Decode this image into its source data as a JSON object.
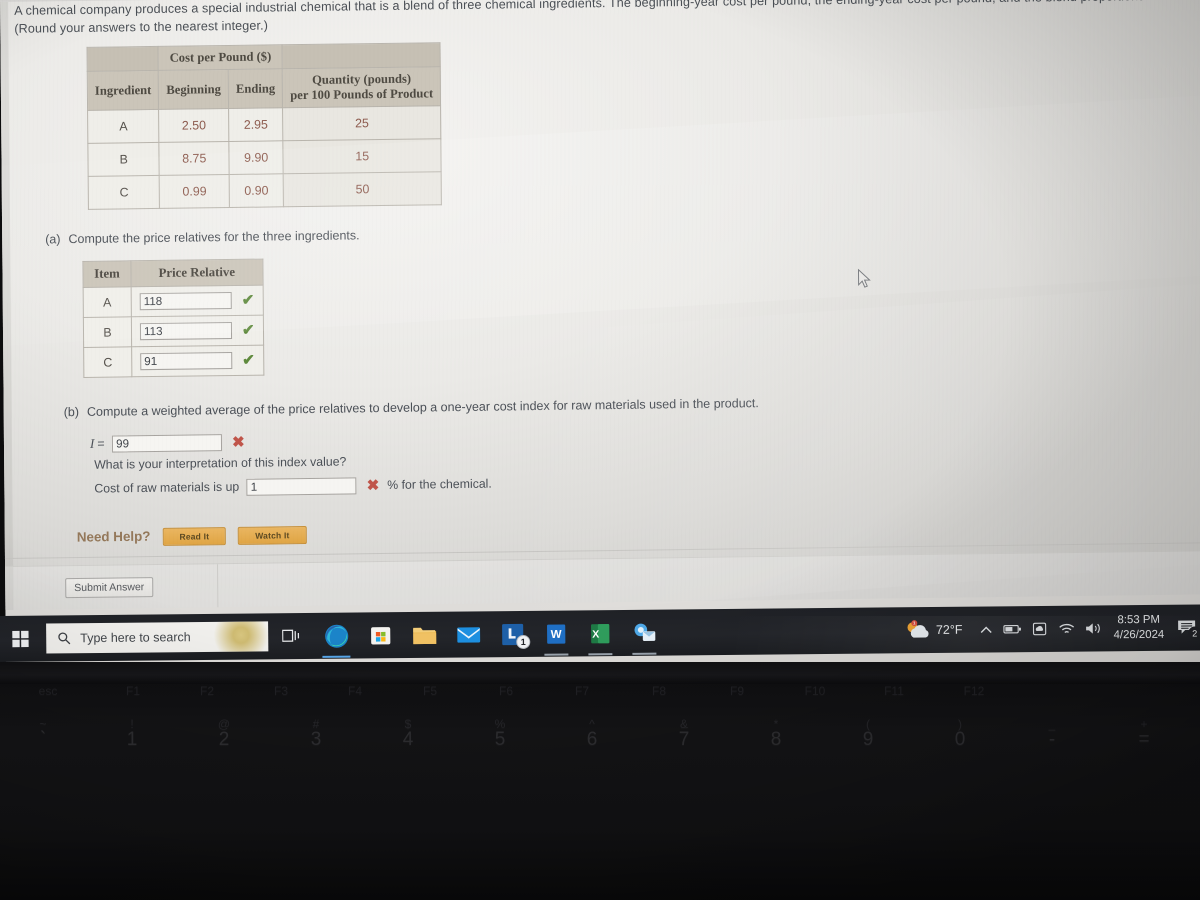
{
  "question": {
    "prompt_line1": "A chemical company produces a special industrial chemical that is a blend of three chemical ingredients. The beginning-year cost per pound, the ending-year cost per pound, and the blend proportions follow.",
    "prompt_line2": "(Round your answers to the nearest integer.)"
  },
  "data_table": {
    "group_header": "Cost per Pound ($)",
    "headers": [
      "Ingredient",
      "Beginning",
      "Ending",
      "Quantity (pounds)\nper 100 Pounds of Product"
    ],
    "quantity_header_line1": "Quantity (pounds)",
    "quantity_header_line2": "per 100 Pounds of Product",
    "rows": [
      {
        "ingredient": "A",
        "beginning": "2.50",
        "ending": "2.95",
        "quantity": "25"
      },
      {
        "ingredient": "B",
        "beginning": "8.75",
        "ending": "9.90",
        "quantity": "15"
      },
      {
        "ingredient": "C",
        "beginning": "0.99",
        "ending": "0.90",
        "quantity": "50"
      }
    ]
  },
  "part_a": {
    "label": "(a)",
    "text": "Compute the price relatives for the three ingredients.",
    "headers": [
      "Item",
      "Price Relative"
    ],
    "rows": [
      {
        "item": "A",
        "value": "118",
        "mark": "correct",
        "mark_glyph": "✔"
      },
      {
        "item": "B",
        "value": "113",
        "mark": "correct",
        "mark_glyph": "✔"
      },
      {
        "item": "C",
        "value": "91",
        "mark": "correct",
        "mark_glyph": "✔"
      }
    ]
  },
  "part_b": {
    "label": "(b)",
    "text": "Compute a weighted average of the price relatives to develop a one-year cost index for raw materials used in the product.",
    "equation_symbol": "I",
    "equation_equals": "=",
    "index_value": "99",
    "index_mark": "incorrect",
    "index_mark_glyph": "✖",
    "interpretation_question": "What is your interpretation of this index value?",
    "interpretation_prefix": "Cost of raw materials is up",
    "interpretation_value": "1",
    "interpretation_mark": "incorrect",
    "interpretation_mark_glyph": "✖",
    "interpretation_suffix": "% for the chemical."
  },
  "help": {
    "label": "Need Help?",
    "read_button": "Read It",
    "watch_button": "Watch It"
  },
  "submit": {
    "label": "Submit Answer"
  },
  "colors": {
    "correct_green": "#5f8a3d",
    "incorrect_red": "#c0554a",
    "table_header_tan": "#cbc5b9",
    "help_orange": "#e0a544",
    "value_maroon": "#8d5b4e",
    "taskbar_dark": "#23252a"
  },
  "taskbar": {
    "start_icon": "windows-logo-icon",
    "search_placeholder": "Type here to search",
    "search_icon": "search-icon",
    "task_view_icon": "task-view-icon",
    "pinned_apps": [
      {
        "name": "microsoft-edge",
        "icon": "edge-icon",
        "badge": null
      },
      {
        "name": "microsoft-store",
        "icon": "store-icon",
        "badge": null
      },
      {
        "name": "file-explorer",
        "icon": "folder-icon",
        "badge": null
      },
      {
        "name": "mail",
        "icon": "envelope-icon",
        "badge": null
      },
      {
        "name": "linkedin",
        "icon": "linkedin-icon",
        "badge": "1"
      },
      {
        "name": "word",
        "icon": "word-icon",
        "badge": null
      },
      {
        "name": "excel",
        "icon": "excel-icon",
        "badge": null
      },
      {
        "name": "outlook",
        "icon": "outlook-icon",
        "badge": null
      }
    ],
    "tray": {
      "weather_icon": "partly-cloudy-icon",
      "weather_temp": "72°F",
      "chevron_icon": "chevron-up-icon",
      "battery_icon": "battery-icon",
      "onedrive_icon": "onedrive-icon",
      "wifi_icon": "wifi-icon",
      "volume_icon": "speaker-icon",
      "time": "8:53 PM",
      "date": "4/26/2024",
      "notifications_icon": "notification-icon",
      "notifications_count": "2"
    }
  },
  "keyboard": {
    "function_row": [
      "esc",
      "F1",
      "F2",
      "F3",
      "F4",
      "F5",
      "F6",
      "F7",
      "F8",
      "F9",
      "F10",
      "F11",
      "F12"
    ],
    "number_row": [
      {
        "sup": "~",
        "num": "`"
      },
      {
        "sup": "!",
        "num": "1"
      },
      {
        "sup": "@",
        "num": "2"
      },
      {
        "sup": "#",
        "num": "3"
      },
      {
        "sup": "$",
        "num": "4"
      },
      {
        "sup": "%",
        "num": "5"
      },
      {
        "sup": "^",
        "num": "6"
      },
      {
        "sup": "&",
        "num": "7"
      },
      {
        "sup": "*",
        "num": "8"
      },
      {
        "sup": "(",
        "num": "9"
      },
      {
        "sup": ")",
        "num": "0"
      },
      {
        "sup": "_",
        "num": "-"
      },
      {
        "sup": "+",
        "num": "="
      }
    ]
  }
}
